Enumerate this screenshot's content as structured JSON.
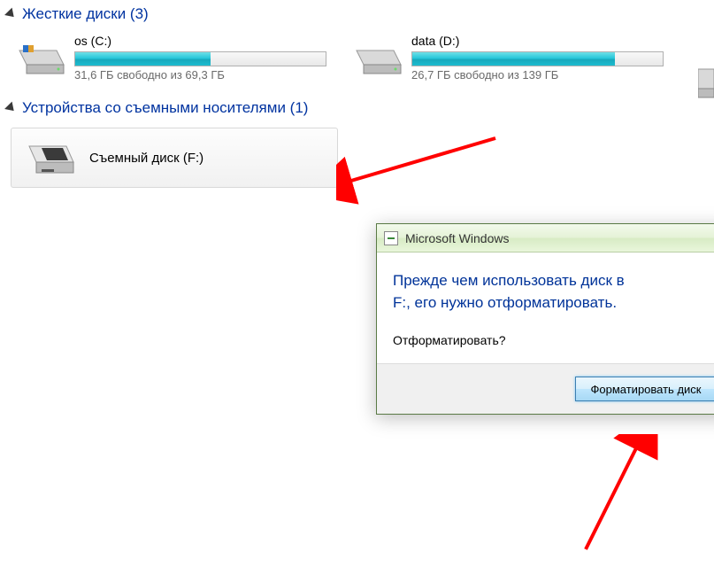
{
  "hard_drives_section": {
    "title": "Жесткие диски (3)",
    "drives": [
      {
        "label": "os (C:)",
        "fill_percent": 54,
        "free_text": "31,6 ГБ свободно из 69,3 ГБ"
      },
      {
        "label": "data (D:)",
        "fill_percent": 81,
        "free_text": "26,7 ГБ свободно из 139 ГБ"
      }
    ]
  },
  "removable_section": {
    "title": "Устройства со съемными носителями (1)",
    "item_label": "Съемный диск (F:)"
  },
  "dialog": {
    "title": "Microsoft Windows",
    "message_line1": "Прежде чем использовать диск в",
    "message_line2": "F:, его нужно отформатировать.",
    "question": "Отформатировать?",
    "format_button": "Форматировать диск"
  }
}
